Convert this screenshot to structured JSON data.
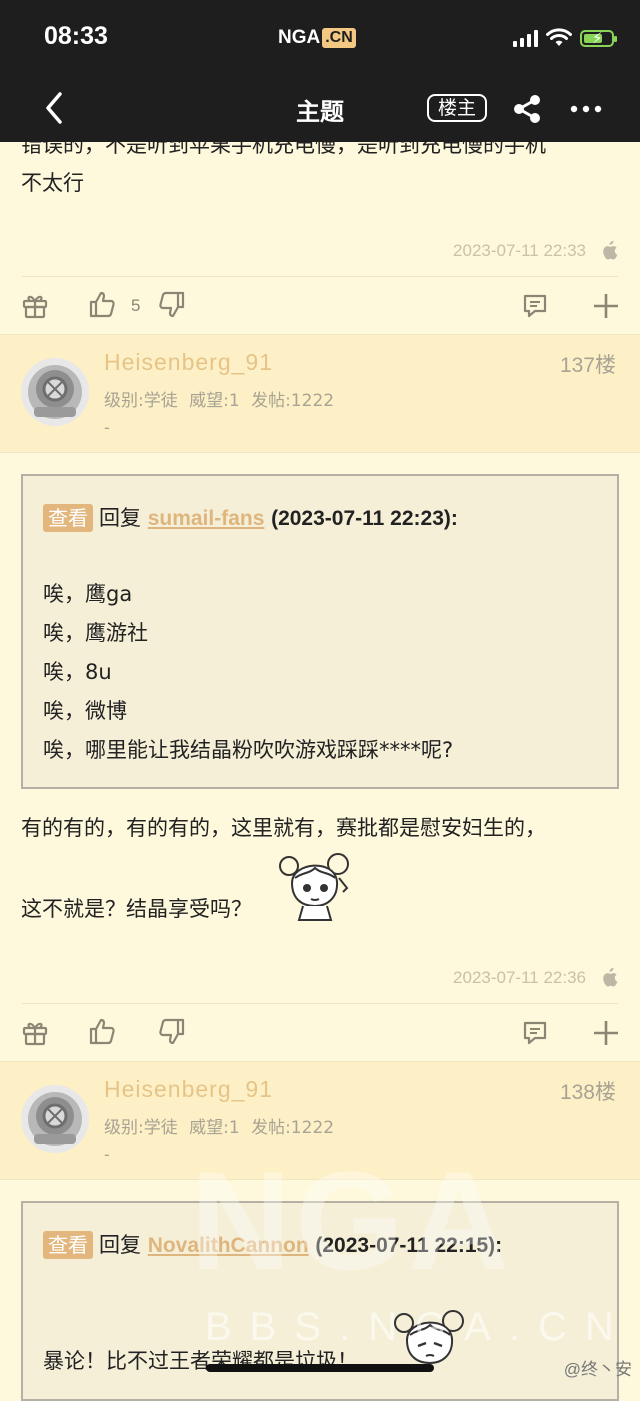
{
  "status_bar": {
    "time": "08:33",
    "logo_main": "NGA",
    "logo_cn": ".CN"
  },
  "nav": {
    "title": "主题",
    "louzhu_label": "楼主"
  },
  "prev_post": {
    "text_line1": "错误的，不是听到苹果手机充电慢，是听到充电慢的手机",
    "text_line2": "不太行",
    "timestamp": "2023-07-11 22:33",
    "like_count": "5"
  },
  "posts": [
    {
      "username": "Heisenberg_91",
      "floor": "137楼",
      "meta": "级别:学徒  威望:1  发帖:1222",
      "dash": "-",
      "quote": {
        "view_label": "查看",
        "reply_label": "回复",
        "reply_user": "sumail-fans",
        "reply_time": "(2023-07-11 22:23):",
        "lines": [
          "唉，鹰ga",
          "唉，鹰游社",
          "唉，8u",
          "唉，微博",
          "唉，哪里能让我结晶粉吹吹游戏踩踩****呢?"
        ]
      },
      "body_line1": "有的有的，有的有的，这里就有，赛批都是慰安妇生的，",
      "body_line2": "这不就是？结晶享受吗？",
      "timestamp": "2023-07-11 22:36"
    },
    {
      "username": "Heisenberg_91",
      "floor": "138楼",
      "meta": "级别:学徒  威望:1  发帖:1222",
      "dash": "-",
      "quote": {
        "view_label": "查看",
        "reply_label": "回复",
        "reply_user": "NovalithCannon",
        "reply_time": "(2023-07-11 22:15):",
        "line1": "暴论！比不过王者荣耀都是垃圾！"
      }
    }
  ],
  "watermark": {
    "main": "NGA",
    "sub": "BBS.NGA.CN"
  },
  "weibo_tag": "@终丶安",
  "colors": {
    "background": "#fef8dc",
    "header_bg": "#fdf0c6",
    "username": "#e6c488",
    "topbar": "#1e1e1e",
    "accent_tag": "#e3b67e"
  }
}
